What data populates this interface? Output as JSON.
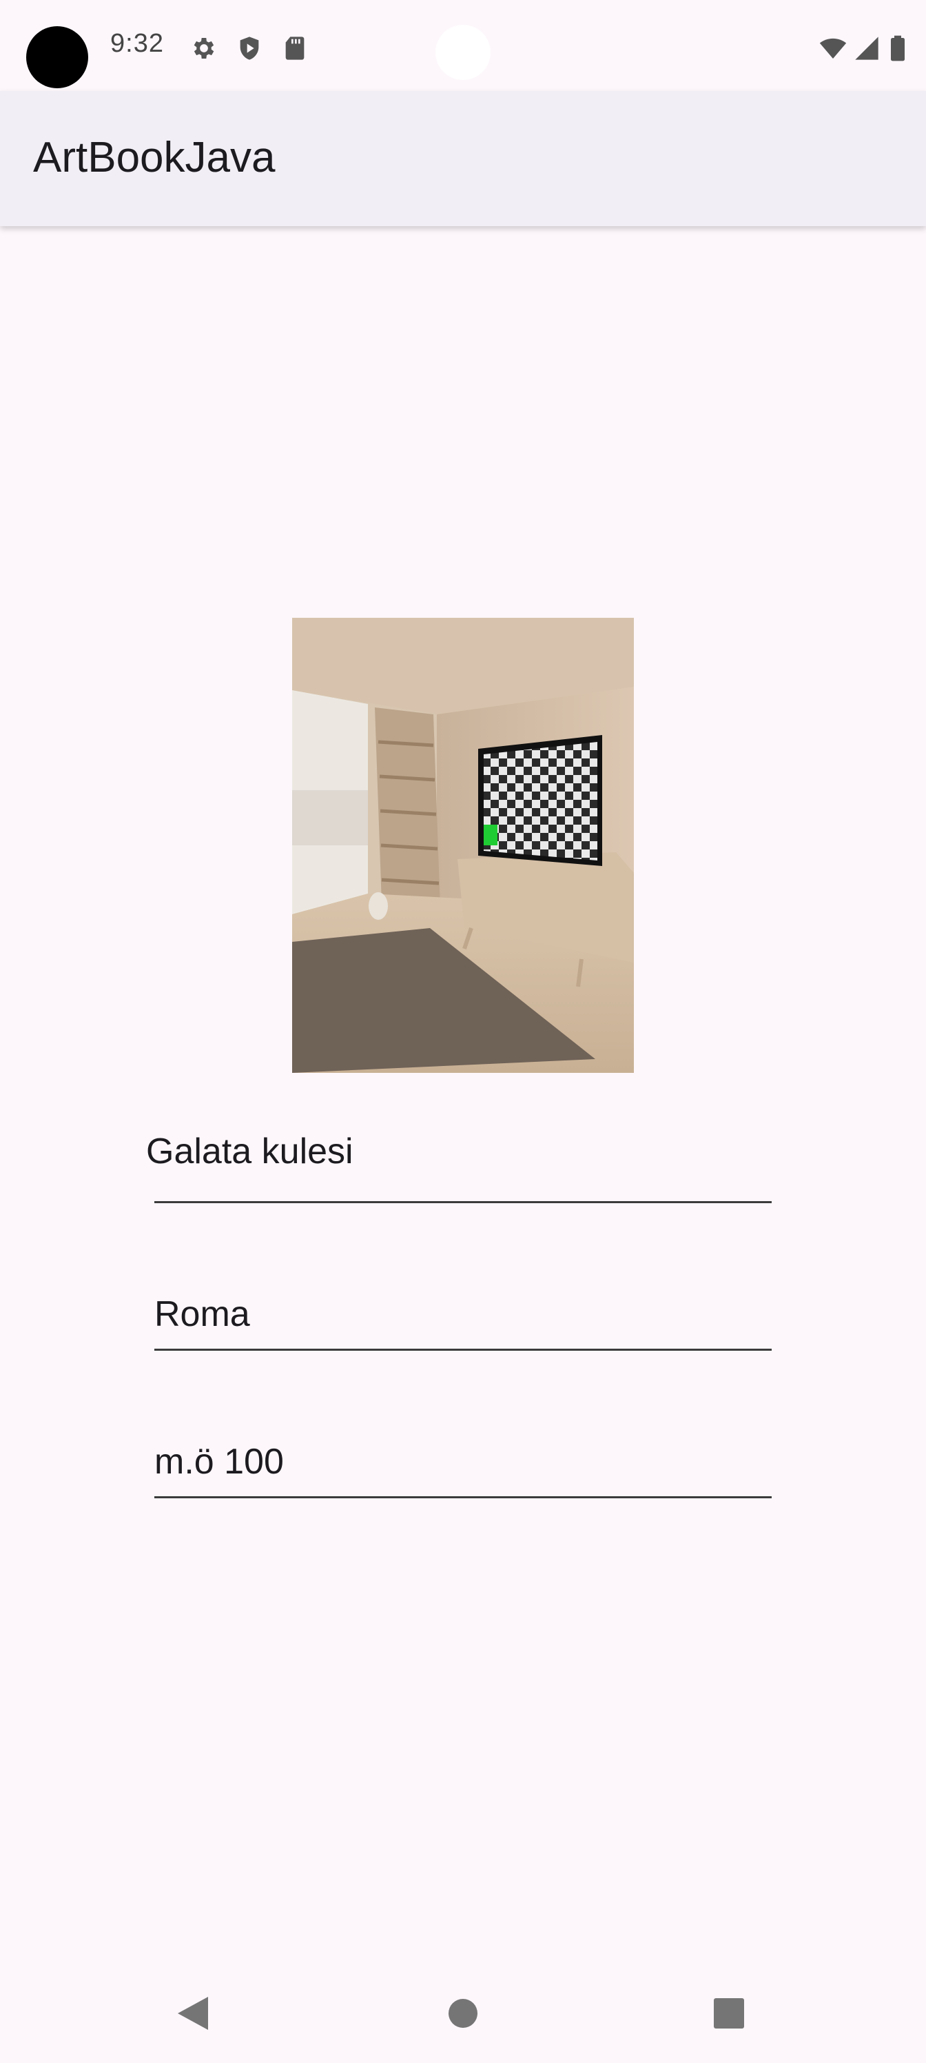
{
  "status_bar": {
    "time": "9:32",
    "left_icons": [
      "gear-icon",
      "shield-icon",
      "sd-card-icon"
    ],
    "right_icons": [
      "wifi-icon",
      "cell-signal-icon",
      "battery-icon"
    ]
  },
  "app_bar": {
    "title": "ArtBookJava"
  },
  "form": {
    "art_name": "Galata kulesi",
    "artist_name": "Roma",
    "year": "m.ö 100"
  },
  "navigation": {
    "back_icon": "back-triangle-icon",
    "home_icon": "home-circle-icon",
    "recents_icon": "recents-square-icon"
  },
  "colors": {
    "background": "#fdf7fb",
    "app_bar": "#f2eef5",
    "text": "#1c1b1f",
    "underline": "#3b3b3b",
    "nav_icon": "#757575"
  }
}
